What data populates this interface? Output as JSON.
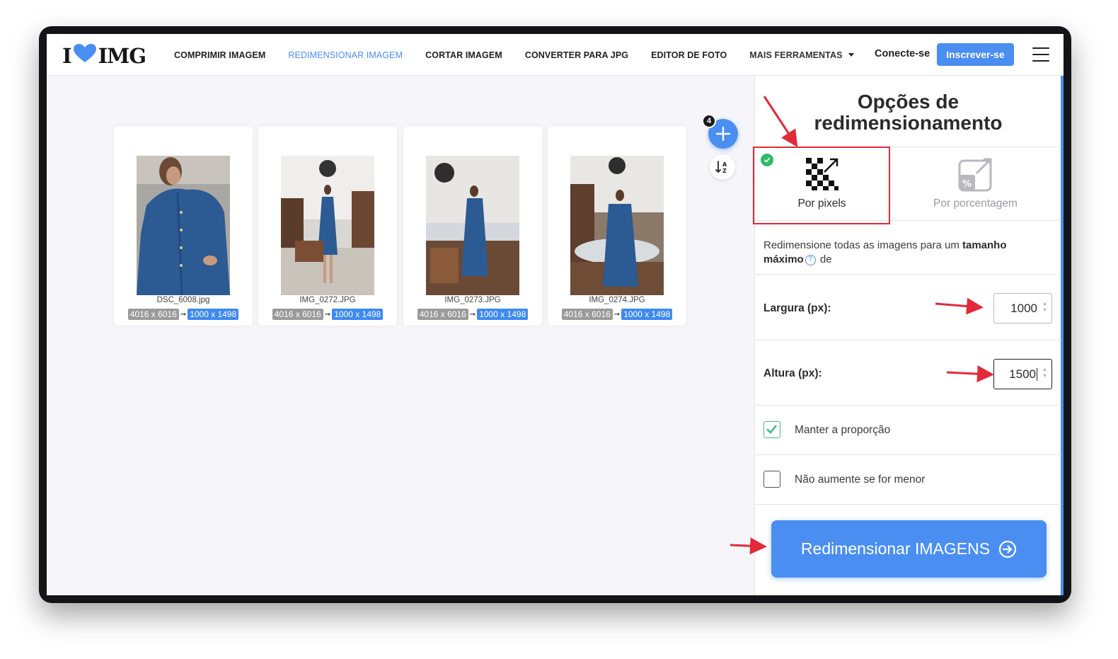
{
  "logo": {
    "left": "I",
    "right": "IMG"
  },
  "nav": {
    "items": [
      {
        "label": "COMPRIMIR IMAGEM"
      },
      {
        "label": "REDIMENSIONAR IMAGEM"
      },
      {
        "label": "CORTAR IMAGEM"
      },
      {
        "label": "CONVERTER PARA JPG"
      },
      {
        "label": "EDITOR DE FOTO"
      },
      {
        "label": "MAIS FERRAMENTAS"
      }
    ],
    "login_label": "Conecte-se",
    "signup_label": "Inscrever-se"
  },
  "files": [
    {
      "name": "DSC_6008.jpg",
      "original": "4016 x 6016",
      "resized": "1000 x 1498"
    },
    {
      "name": "IMG_0272.JPG",
      "original": "4016 x 6016",
      "resized": "1000 x 1498"
    },
    {
      "name": "IMG_0273.JPG",
      "original": "4016 x 6016",
      "resized": "1000 x 1498"
    },
    {
      "name": "IMG_0274.JPG",
      "original": "4016 x 6016",
      "resized": "1000 x 1498"
    }
  ],
  "file_count": "4",
  "sidebar": {
    "title_line1": "Opções de",
    "title_line2": "redimensionamento",
    "mode_pixels": "Por pixels",
    "mode_percent": "Por porcentagem",
    "desc_prefix": "Redimensione todas as imagens para um ",
    "desc_bold": "tamanho máximo",
    "desc_suffix": " de",
    "width_label": "Largura (px):",
    "width_value": "1000",
    "height_label": "Altura (px):",
    "height_value": "1500",
    "keep_ratio_label": "Manter a proporção",
    "keep_ratio_checked": true,
    "no_upscale_label": "Não aumente se for menor",
    "no_upscale_checked": false,
    "submit_label": "Redimensionar IMAGENS"
  },
  "colors": {
    "accent": "#4a8ef2",
    "annotation": "#e22a3a",
    "success": "#2fba6b"
  }
}
